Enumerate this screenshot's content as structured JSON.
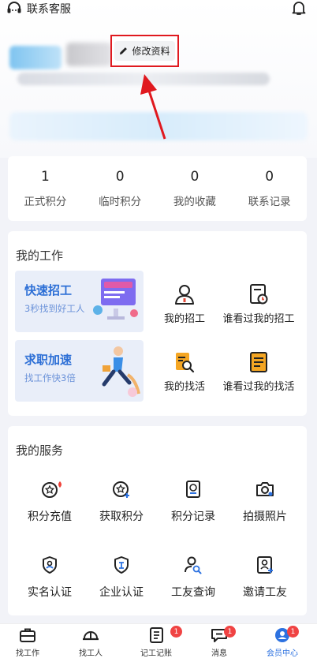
{
  "topbar": {
    "service_label": "联系客服"
  },
  "profile": {
    "edit_label": "修改资料"
  },
  "stats": [
    {
      "value": "1",
      "label": "正式积分"
    },
    {
      "value": "0",
      "label": "临时积分"
    },
    {
      "value": "0",
      "label": "我的收藏"
    },
    {
      "value": "0",
      "label": "联系记录"
    }
  ],
  "work": {
    "title": "我的工作",
    "promo1": {
      "title": "快速招工",
      "sub": "3秒找到好工人"
    },
    "promo2": {
      "title": "求职加速",
      "sub": "找工作快3倍"
    },
    "items": [
      {
        "label": "我的招工",
        "icon": "person-icon"
      },
      {
        "label": "谁看过我的招工",
        "icon": "document-clock-icon"
      },
      {
        "label": "我的找活",
        "icon": "document-search-icon"
      },
      {
        "label": "谁看过我的找活",
        "icon": "document-list-icon"
      }
    ]
  },
  "services": {
    "title": "我的服务",
    "items": [
      {
        "label": "积分充值",
        "icon": "points-recharge-icon"
      },
      {
        "label": "获取积分",
        "icon": "points-get-icon"
      },
      {
        "label": "积分记录",
        "icon": "points-record-icon"
      },
      {
        "label": "拍摄照片",
        "icon": "camera-icon"
      },
      {
        "label": "实名认证",
        "icon": "shield-person-icon"
      },
      {
        "label": "企业认证",
        "icon": "shield-enterprise-icon"
      },
      {
        "label": "工友查询",
        "icon": "person-search-icon"
      },
      {
        "label": "邀请工友",
        "icon": "person-add-icon"
      }
    ]
  },
  "tabs": [
    {
      "label": "找工作",
      "icon": "briefcase-icon"
    },
    {
      "label": "找工人",
      "icon": "helmet-icon"
    },
    {
      "label": "记工记账",
      "icon": "ledger-icon",
      "badge": "1"
    },
    {
      "label": "消息",
      "icon": "message-icon",
      "badge": "1"
    },
    {
      "label": "会员中心",
      "icon": "member-icon",
      "badge": "1",
      "active": true
    }
  ],
  "colors": {
    "accent": "#2d72e0",
    "highlight_box": "#e0191f",
    "badge": "#f04343"
  }
}
